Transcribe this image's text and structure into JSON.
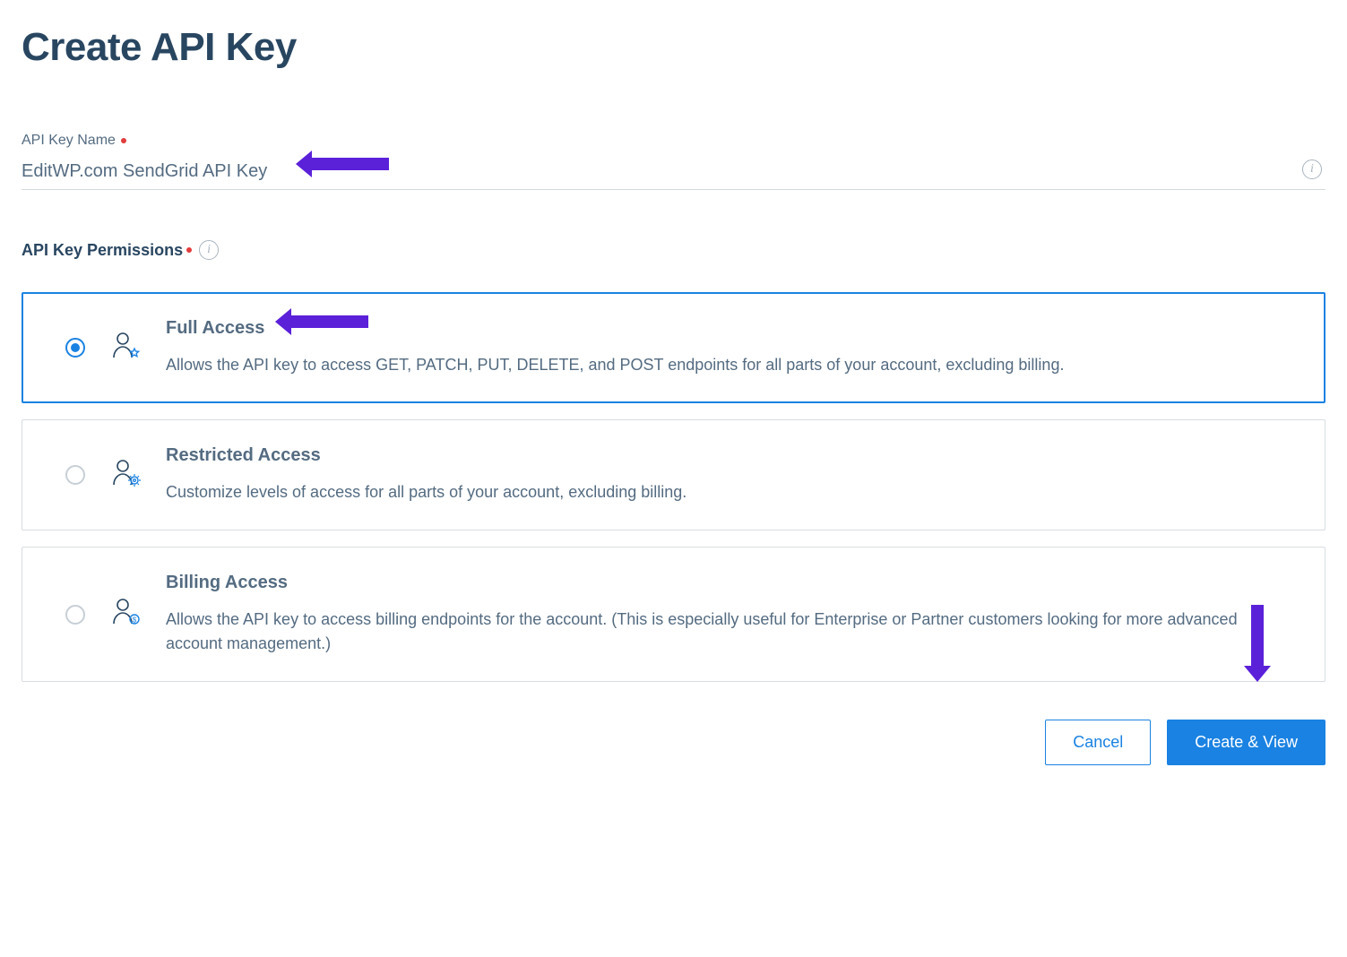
{
  "page": {
    "title": "Create API Key"
  },
  "form": {
    "name_label": "API Key Name",
    "name_value": "EditWP.com SendGrid API Key",
    "permissions_label": "API Key Permissions"
  },
  "options": {
    "full": {
      "title": "Full Access",
      "desc": "Allows the API key to access GET, PATCH, PUT, DELETE, and POST endpoints for all parts of your account, excluding billing."
    },
    "restricted": {
      "title": "Restricted Access",
      "desc": "Customize levels of access for all parts of your account, excluding billing."
    },
    "billing": {
      "title": "Billing Access",
      "desc": "Allows the API key to access billing endpoints for the account. (This is especially useful for Enterprise or Partner customers looking for more advanced account management.)"
    }
  },
  "actions": {
    "cancel": "Cancel",
    "create": "Create & View"
  }
}
